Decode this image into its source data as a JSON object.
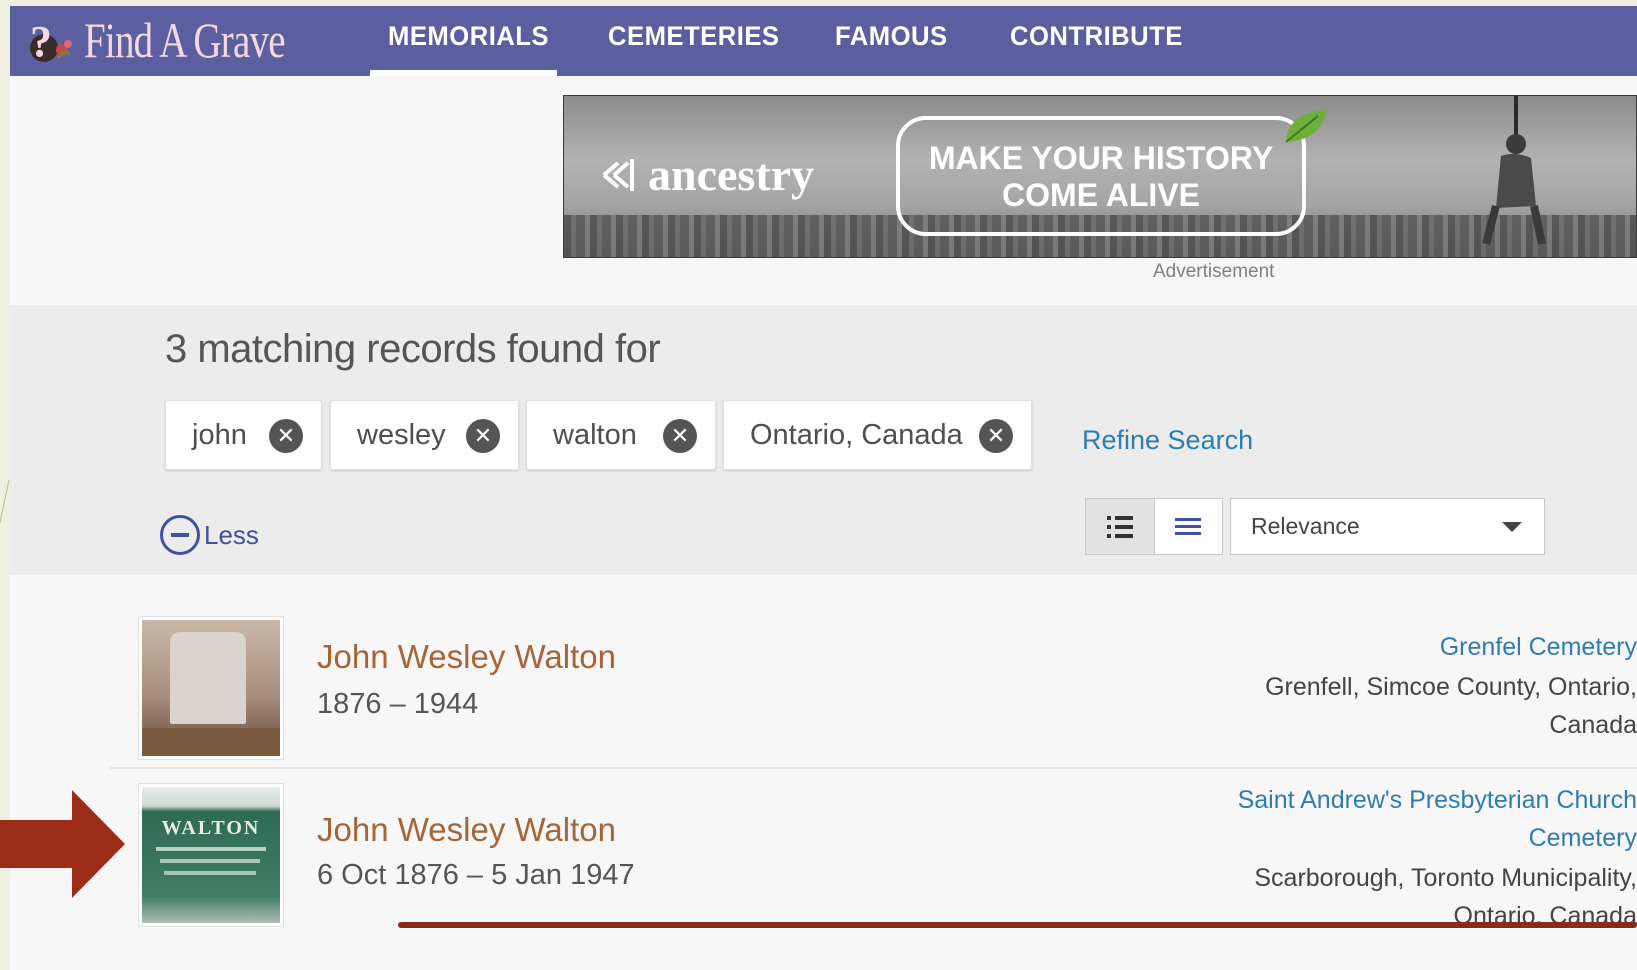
{
  "header": {
    "logo_text": "Find A Grave",
    "nav": [
      "MEMORIALS",
      "CEMETERIES",
      "FAMOUS",
      "CONTRIBUTE"
    ],
    "active_nav": "MEMORIALS",
    "brand_color": "#5b5e9f"
  },
  "ad": {
    "brand": "ancestry",
    "headline_line1": "MAKE YOUR HISTORY",
    "headline_line2": "COME ALIVE",
    "caption": "Advertisement"
  },
  "search": {
    "heading": "3 matching records found for",
    "chips": [
      "john",
      "wesley",
      "walton",
      "Ontario, Canada"
    ],
    "refine_label": "Refine Search",
    "less_label": "Less",
    "sort_value": "Relevance"
  },
  "results": [
    {
      "name": "John Wesley Walton",
      "dates": "1876 – 1944",
      "cemetery_line1": "Grenfel Cemetery",
      "location_line1": "Grenfell, Simcoe County, Ontario,",
      "location_line2": "Canada"
    },
    {
      "name": "John Wesley Walton",
      "dates": "6 Oct 1876 – 5 Jan 1947",
      "cemetery_line1": "Saint Andrew's Presbyterian Church",
      "cemetery_line2": "Cemetery",
      "location_line1": "Scarborough, Toronto Municipality,",
      "location_line2": "Ontario, Canada",
      "thumb_text": "WALTON"
    }
  ],
  "colors": {
    "link_blue": "#2d7db3",
    "name_brown": "#a56538",
    "annotation_red": "#9b2d16"
  }
}
